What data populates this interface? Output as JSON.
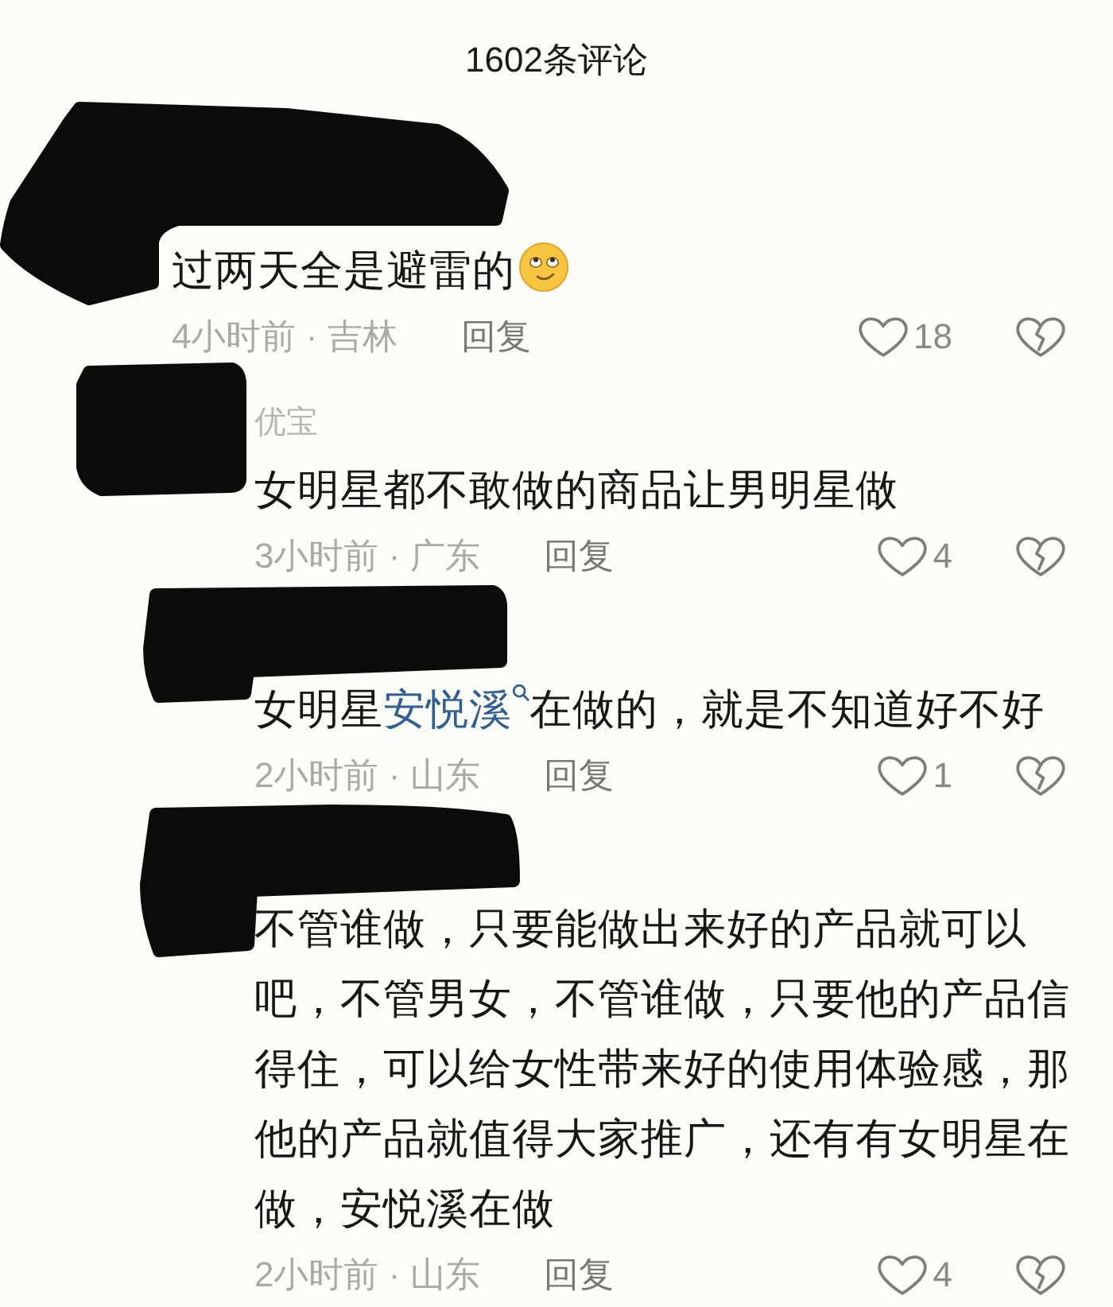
{
  "header": {
    "title": "1602条评论"
  },
  "comments": [
    {
      "redacted": true,
      "body": [
        {
          "kind": "text",
          "text": "过两天全是避雷的"
        },
        {
          "kind": "emoji"
        }
      ],
      "meta": "4小时前 · 吉林",
      "reply_label": "回复",
      "likes": "18",
      "children": [
        {
          "redacted": true,
          "username": "优宝",
          "body": [
            {
              "kind": "text",
              "text": "女明星都不敢做的商品让男明星做"
            }
          ],
          "meta": "3小时前 · 广东",
          "reply_label": "回复",
          "likes": "4"
        },
        {
          "redacted": true,
          "body": [
            {
              "kind": "text",
              "text": "女明星"
            },
            {
              "kind": "search_link",
              "text": "安悦溪"
            },
            {
              "kind": "text",
              "text": "在做的，就是不知道好不好"
            }
          ],
          "meta": "2小时前 · 山东",
          "reply_label": "回复",
          "likes": "1"
        },
        {
          "redacted": true,
          "body": [
            {
              "kind": "text",
              "text": "不管谁做，只要能做出来好的产品就可以吧，不管男女，不管谁做，只要他的产品信得住，可以给女性带来好的使用体验感，那他的产品就值得大家推广，还有有女明星在做，安悦溪在做"
            }
          ],
          "meta": "2小时前 · 山东",
          "reply_label": "回复",
          "likes": "4"
        }
      ]
    }
  ]
}
